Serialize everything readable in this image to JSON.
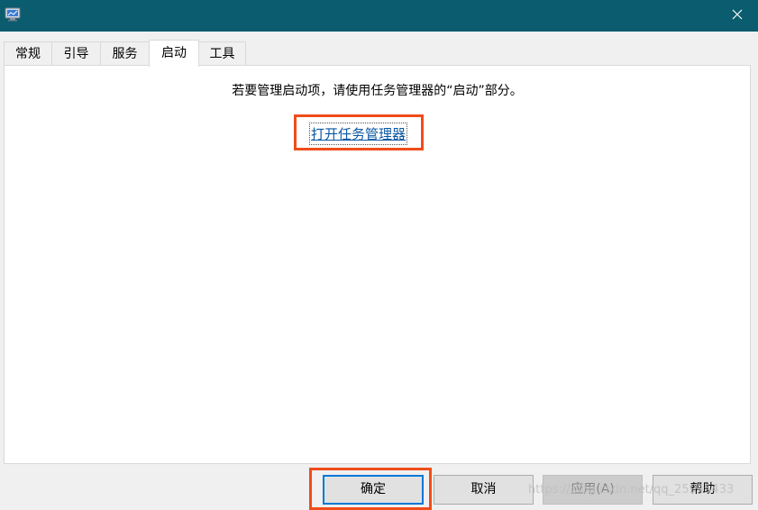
{
  "window": {
    "title_bar_color": "#0a5c6e",
    "app_icon": "msconfig-monitor-icon",
    "close_icon": "close-icon"
  },
  "tabs": [
    {
      "label": "常规",
      "active": false
    },
    {
      "label": "引导",
      "active": false
    },
    {
      "label": "服务",
      "active": false
    },
    {
      "label": "启动",
      "active": true
    },
    {
      "label": "工具",
      "active": false
    }
  ],
  "startup_panel": {
    "message": "若要管理启动项，请使用任务管理器的“启动”部分。",
    "link_label": "打开任务管理器"
  },
  "buttons": {
    "ok": "确定",
    "cancel": "取消",
    "apply": "应用(A)",
    "help": "帮助"
  },
  "highlight_color": "#f04d1a",
  "accent_color": "#0078d7",
  "watermark": "https://blog.csdn.net/qq_25945433"
}
